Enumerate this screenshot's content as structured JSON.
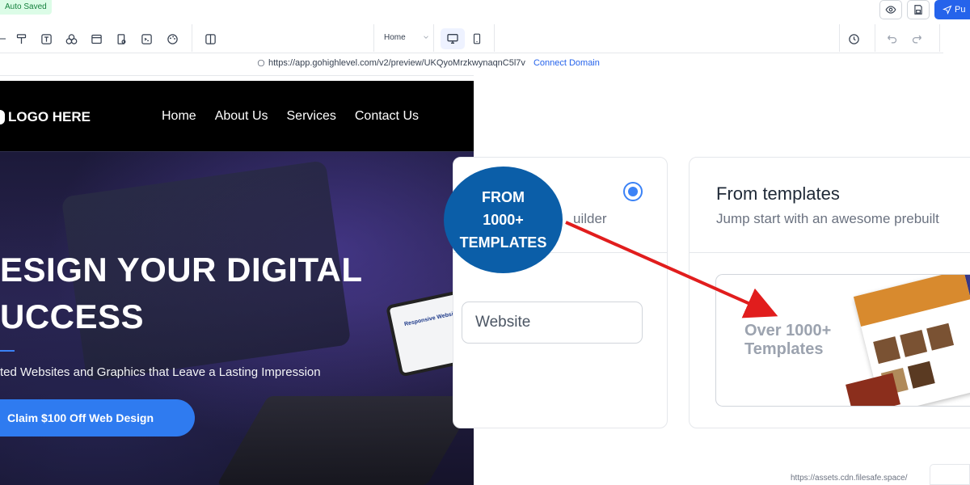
{
  "builder": {
    "autosave_label": "Auto Saved",
    "publish_label": "Pu",
    "page_select": "Home",
    "url": "https://app.gohighlevel.com/v2/preview/UKQyoMrzkwynaqnC5l7v",
    "connect_domain_label": "Connect Domain"
  },
  "site": {
    "logo": "LOGO HERE",
    "nav": [
      "Home",
      "About Us",
      "Services",
      "Contact Us"
    ],
    "hero_title_line1": "ESIGN YOUR DIGITAL",
    "hero_title_line2": "UCCESS",
    "hero_subtitle": "ted Websites and Graphics that Leave a Lasting Impression",
    "cta_label": "Claim $100 Off Web Design",
    "tablet_text": "Responsive Website Design"
  },
  "cards": {
    "blank": {
      "subtitle": "uilder",
      "input_value": "Website",
      "selected": true
    },
    "templates": {
      "title": "From templates",
      "subtitle": "Jump start with an awesome prebuilt",
      "preview_text_line1": "Over 1000+",
      "preview_text_line2": "Templates"
    }
  },
  "overlay": {
    "badge_line1": "FROM",
    "badge_line2": "1000+",
    "badge_line3": "TEMPLATES",
    "badge_color": "#0b5ea8",
    "arrow_color": "#e11d1d"
  },
  "footer": {
    "status_url": "https://assets.cdn.filesafe.space/"
  }
}
